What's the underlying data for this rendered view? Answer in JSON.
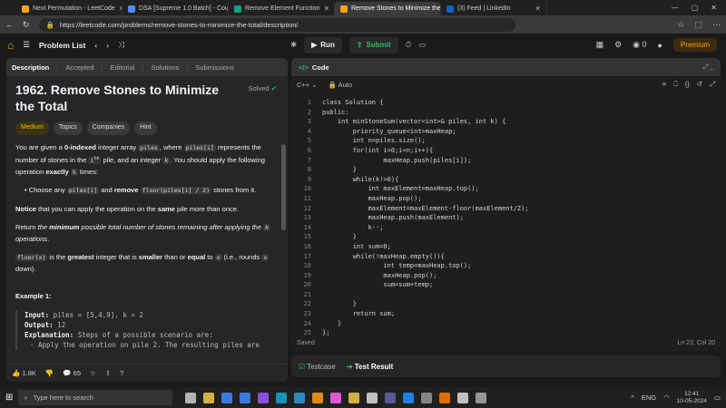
{
  "browser": {
    "tabs": [
      {
        "title": "Next Permutation - LeetCode",
        "color": "#ffa116"
      },
      {
        "title": "DSA [Supreme 1.0 Batch] - Cour",
        "color": "#4e8cff"
      },
      {
        "title": "Remove Element Function",
        "color": "#10a37f"
      },
      {
        "title": "Remove Stones to Minimize the",
        "color": "#ffa116",
        "active": true
      },
      {
        "title": "(3) Feed | LinkedIn",
        "color": "#0a66c2"
      }
    ],
    "url": "https://leetcode.com/problems/remove-stones-to-minimize-the-total/description/"
  },
  "nav": {
    "problem_list": "Problem List",
    "run": "Run",
    "submit": "Submit",
    "count": "0",
    "premium": "Premium"
  },
  "left": {
    "tabs": [
      "Description",
      "Accepted",
      "Editorial",
      "Solutions",
      "Submissions"
    ],
    "title": "1962. Remove Stones to Minimize the Total",
    "solved": "Solved",
    "tags": [
      "Medium",
      "Topics",
      "Companies",
      "Hint"
    ],
    "para1_a": "You are given a ",
    "para1_b": "0-indexed",
    "para1_c": " integer array ",
    "para1_d": "piles",
    "para1_e": ", where ",
    "para1_f": "piles[i]",
    "para1_g": " represents the number of stones in the ",
    "para1_h": "i",
    "para1_h_sup": "th",
    "para1_i": " pile, and an integer ",
    "para1_j": "k",
    "para1_k": ". You should apply the following operation ",
    "para1_l": "exactly",
    "para1_m": " ",
    "para1_n": "k",
    "para1_o": " times:",
    "bullet_a": "Choose any ",
    "bullet_b": "piles[i]",
    "bullet_c": " and ",
    "bullet_d": "remove",
    "bullet_e": "floor(piles[i] / 2)",
    "bullet_f": " stones from it.",
    "notice_a": "Notice",
    "notice_b": " that you can apply the operation on the ",
    "notice_c": "same",
    "notice_d": " pile more than once.",
    "ret_a": "Return ",
    "ret_b": "the ",
    "ret_c": "minimum",
    "ret_d": " possible total number of stones remaining after applying the ",
    "ret_e": "k",
    "ret_f": " operations",
    "floor_a": "floor(x)",
    "floor_b": " is the ",
    "floor_c": "greatest",
    "floor_d": " integer that is ",
    "floor_e": "smaller",
    "floor_f": " than or ",
    "floor_g": "equal",
    "floor_h": " to ",
    "floor_i": "x",
    "floor_j": " (i.e., rounds ",
    "floor_k": "x",
    "floor_l": " down).",
    "example_title": "Example 1:",
    "ex_input_label": "Input:",
    "ex_input": " piles = [5,4,9], k = 2",
    "ex_output_label": "Output:",
    "ex_output": " 12",
    "ex_expl_label": "Explanation:",
    "ex_expl": " Steps of a possible scenario are:",
    "ex_cut": "- Apply the operation on pile 2. The resulting piles are",
    "likes": "1.8K",
    "comments": "65"
  },
  "right": {
    "title": "Code",
    "lang": "C++",
    "auto": "Auto",
    "saved": "Saved",
    "cursor": "Ln 23, Col 20",
    "code": [
      "class Solution {",
      "public:",
      "    int minStoneSum(vector<int>& piles, int k) {",
      "        priority_queue<int>maxHeap;",
      "        int n=piles.size();",
      "        for(int i=0;i<n;i++){",
      "                maxHeap.push(piles[i]);",
      "        }",
      "        while(k!=0){",
      "            int maxElement=maxHeap.top();",
      "            maxHeap.pop();",
      "            maxElement=maxElement-floor(maxElement/2);",
      "            maxHeap.push(maxElement);",
      "            k--;",
      "        }",
      "        int sum=0;",
      "        while(!maxHeap.empty()){",
      "                int temp=maxHeap.top();",
      "                maxHeap.pop();",
      "                sum=sum+temp;",
      "",
      "        }",
      "        return sum;",
      "    }",
      "};"
    ],
    "testcase": "Testcase",
    "test_result": "Test Result"
  },
  "taskbar": {
    "search": "Type here to search",
    "lang": "ENG",
    "time": "12:41",
    "date": "10-05-2024"
  }
}
